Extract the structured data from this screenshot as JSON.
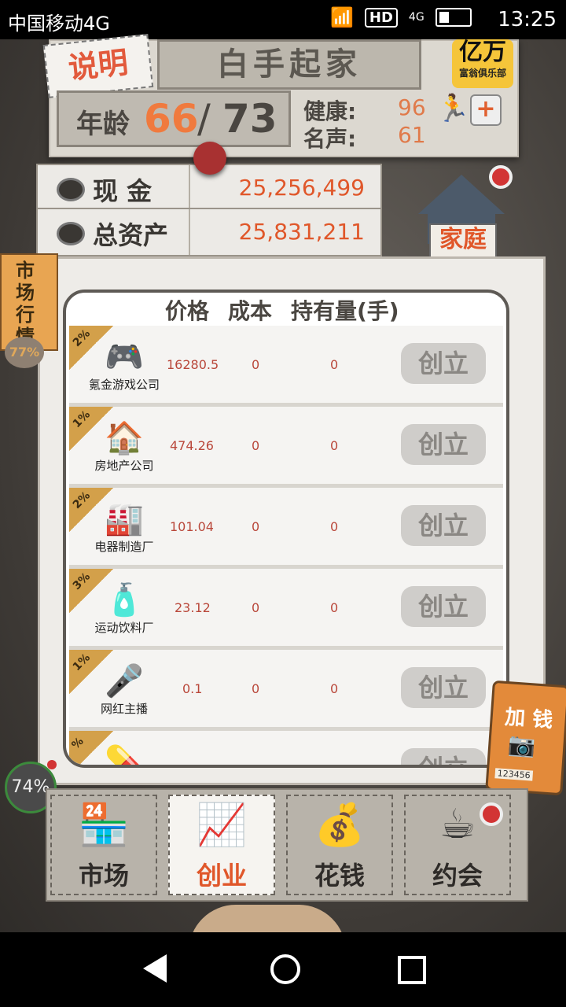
{
  "status_bar": {
    "carrier": "中国移动4G",
    "network_badge": "4G",
    "hd_badge": "HD",
    "time": "13:25"
  },
  "header": {
    "explain_label": "说明",
    "title": "白手起家",
    "club_logo_main": "亿万",
    "club_logo_sub": "富翁俱乐部"
  },
  "age": {
    "label": "年龄",
    "current": "66",
    "separator": "/",
    "max": "73"
  },
  "stats": {
    "health_label": "健康:",
    "health_value": "96",
    "fame_label": "名声:",
    "fame_value": "61",
    "plus_label": "+"
  },
  "money": {
    "cash_label": "现 金",
    "cash_value": "25,256,499",
    "assets_label": "总资产",
    "assets_value": "25,831,211"
  },
  "family_button": {
    "label": "家庭"
  },
  "side_tab": {
    "label": "市场行情",
    "percent": "77%"
  },
  "table": {
    "headers": [
      "价格",
      "成本",
      "持有量(手)"
    ],
    "rows": [
      {
        "tag": "2%",
        "icon": "gamepad-icon",
        "glyph": "🎮",
        "name": "氪金游戏公司",
        "price": "16280.5",
        "cost": "0",
        "holding": "0",
        "button": "创立"
      },
      {
        "tag": "1%",
        "icon": "house-icon",
        "glyph": "🏠",
        "name": "房地产公司",
        "price": "474.26",
        "cost": "0",
        "holding": "0",
        "button": "创立"
      },
      {
        "tag": "2%",
        "icon": "appliance-icon",
        "glyph": "🏭",
        "name": "电器制造厂",
        "price": "101.04",
        "cost": "0",
        "holding": "0",
        "button": "创立"
      },
      {
        "tag": "3%",
        "icon": "bottle-icon",
        "glyph": "🧴",
        "name": "运动饮料厂",
        "price": "23.12",
        "cost": "0",
        "holding": "0",
        "button": "创立"
      },
      {
        "tag": "1%",
        "icon": "microphone-icon",
        "glyph": "🎤",
        "name": "网红主播",
        "price": "0.1",
        "cost": "0",
        "holding": "0",
        "button": "创立"
      },
      {
        "tag": "%",
        "icon": "pill-icon",
        "glyph": "💊",
        "name": "",
        "price": "",
        "cost": "",
        "holding": "",
        "button": "创立"
      }
    ]
  },
  "add_money": {
    "label": "加 钱",
    "code": "123456"
  },
  "memory_badge": "74%",
  "bottom_nav": [
    {
      "label": "市场",
      "icon": "shop-icon",
      "glyph": "🏪",
      "active": false
    },
    {
      "label": "创业",
      "icon": "growth-chart-icon",
      "glyph": "📈",
      "active": true
    },
    {
      "label": "花钱",
      "icon": "hand-coins-icon",
      "glyph": "💰",
      "active": false
    },
    {
      "label": "约会",
      "icon": "coffee-cup-icon",
      "glyph": "☕",
      "active": false
    }
  ]
}
